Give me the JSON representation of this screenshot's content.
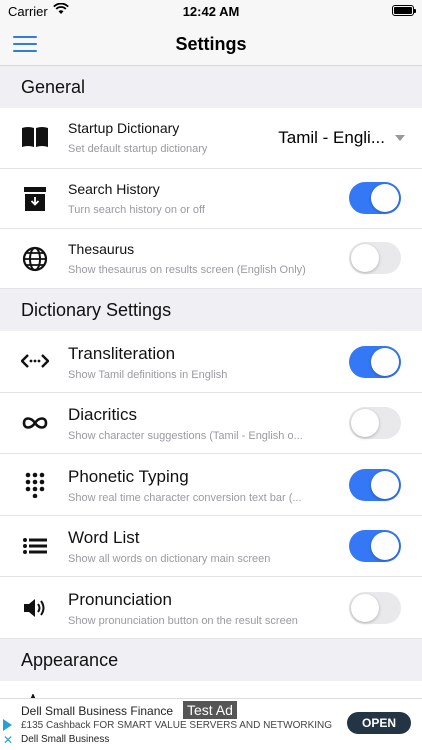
{
  "status_bar": {
    "carrier": "Carrier",
    "time": "12:42 AM"
  },
  "nav": {
    "title": "Settings"
  },
  "sections": {
    "general": "General",
    "dictionary_settings": "Dictionary Settings",
    "appearance": "Appearance"
  },
  "rows": {
    "startup_dictionary": {
      "label": "Startup Dictionary",
      "sub": "Set default startup dictionary",
      "value": "Tamil - Engli..."
    },
    "search_history": {
      "label": "Search History",
      "sub": "Turn search history on or off",
      "toggle": true
    },
    "thesaurus": {
      "label": "Thesaurus",
      "sub": "Show thesaurus on results screen (English Only)",
      "toggle": false
    },
    "transliteration": {
      "label": "Transliteration",
      "sub": "Show Tamil definitions in English",
      "toggle": true
    },
    "diacritics": {
      "label": "Diacritics",
      "sub": "Show character suggestions (Tamil - English o...",
      "toggle": false
    },
    "phonetic_typing": {
      "label": "Phonetic Typing",
      "sub": "Show real time character conversion text bar (...",
      "toggle": true
    },
    "word_list": {
      "label": "Word List",
      "sub": "Show all words on dictionary main screen",
      "toggle": true
    },
    "pronunciation": {
      "label": "Pronunciation",
      "sub": "Show pronunciation button on the result screen",
      "toggle": false
    }
  },
  "ad": {
    "title": "Dell Small Business Finance",
    "badge": "Test Ad",
    "description": "£135 Cashback FOR SMART VALUE SERVERS AND NETWORKING",
    "advertiser": "Dell Small Business",
    "cta": "OPEN"
  },
  "colors": {
    "accent": "#3478f6",
    "menu": "#2f7ed8",
    "toggle_off": "#e9e9eb"
  }
}
